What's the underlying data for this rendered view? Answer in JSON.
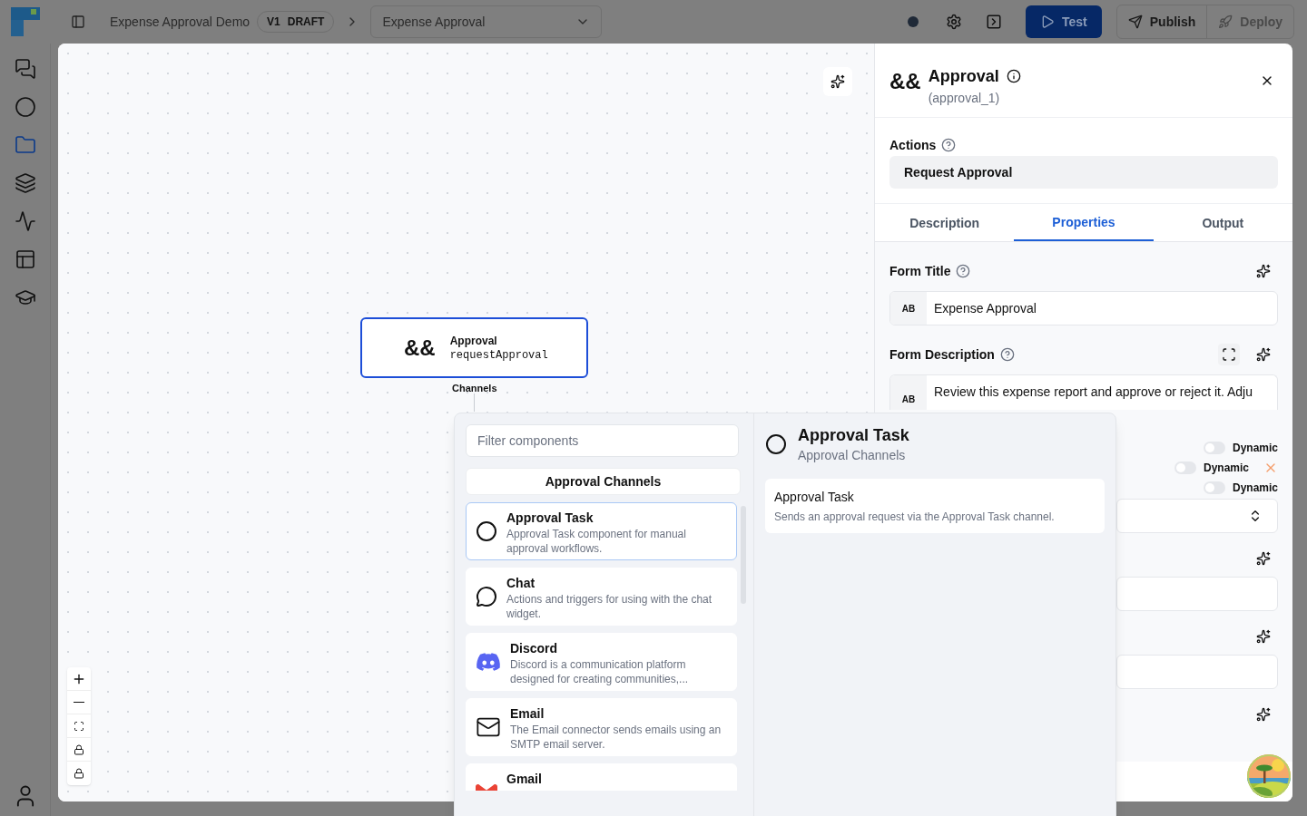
{
  "topbar": {
    "workflow_name": "Expense Approval Demo",
    "version": "V1",
    "status": "DRAFT",
    "page_select": "Expense Approval",
    "buttons": [
      {
        "kind": "test",
        "label": "Test"
      },
      {
        "kind": "publish",
        "label": "Publish"
      },
      {
        "kind": "deploy",
        "label": "Deploy"
      }
    ]
  },
  "sidebar": {
    "items": [
      {
        "kind": "chats",
        "selected": false
      },
      {
        "kind": "circle",
        "selected": false
      },
      {
        "kind": "folder",
        "selected": true
      },
      {
        "kind": "layers",
        "selected": false
      },
      {
        "kind": "activity",
        "selected": false
      },
      {
        "kind": "table",
        "selected": false
      },
      {
        "kind": "learn",
        "selected": false
      }
    ]
  },
  "canvas": {
    "node": {
      "glyph": "&&",
      "title": "Approval",
      "subtitle": "requestApproval",
      "selected": true
    },
    "port_label": "Channels"
  },
  "panel": {
    "glyph": "&&",
    "title": "Approval",
    "id": "(approval_1)",
    "actions_label": "Actions",
    "action_value": "Request Approval",
    "tabs": [
      {
        "label": "Description",
        "selected": false
      },
      {
        "label": "Properties",
        "selected": true
      },
      {
        "label": "Output",
        "selected": false
      }
    ],
    "form_title": {
      "label": "Form Title",
      "prefix": "AB",
      "value": "Expense Approval"
    },
    "form_description": {
      "label": "Form Description",
      "prefix": "AB",
      "value": "Review this expense report and approve or reject it. Adju"
    },
    "toggles": [
      {
        "label": "Dynamic",
        "on": false,
        "clearable": false
      },
      {
        "label": "Dynamic",
        "on": false,
        "clearable": true
      },
      {
        "label": "Dynamic",
        "on": false,
        "clearable": false
      }
    ]
  },
  "popover": {
    "filter_placeholder": "Filter components",
    "category": "Approval Channels",
    "items": [
      {
        "kind": "circle",
        "title": "Approval Task",
        "description": "Approval Task component for manual approval workflows.",
        "selected": true
      },
      {
        "kind": "chat",
        "title": "Chat",
        "description": "Actions and triggers for using with the chat widget.",
        "selected": false
      },
      {
        "kind": "discord",
        "title": "Discord",
        "description": "Discord is a communication platform designed for creating communities,...",
        "selected": false
      },
      {
        "kind": "email",
        "title": "Email",
        "description": "The Email connector sends emails using an SMTP email server.",
        "selected": false
      },
      {
        "kind": "gmail",
        "title": "Gmail",
        "selected": false
      }
    ],
    "detail": {
      "title": "Approval Task",
      "subtitle": "Approval Channels",
      "actions": [
        {
          "title": "Approval Task",
          "description": "Sends an approval request via the Approval Task channel."
        }
      ]
    }
  }
}
